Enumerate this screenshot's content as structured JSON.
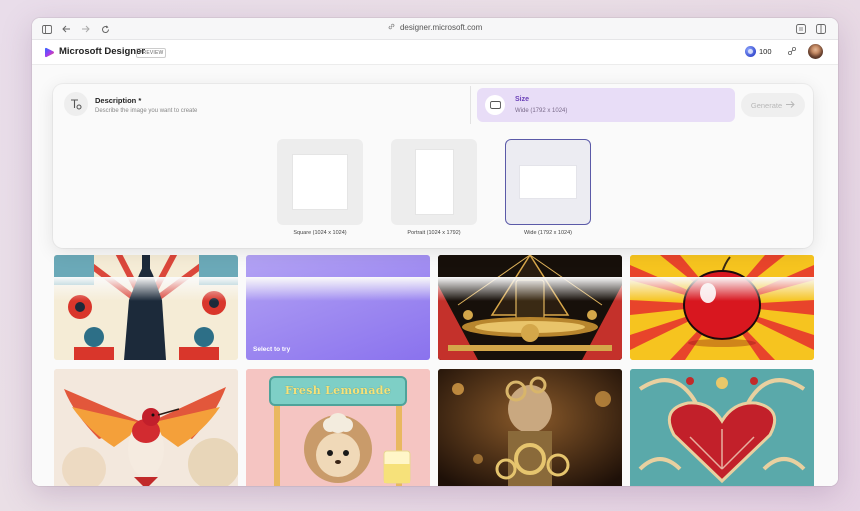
{
  "browser": {
    "url": "designer.microsoft.com"
  },
  "app": {
    "name": "Microsoft Designer",
    "badge": "PREVIEW",
    "credits": "100"
  },
  "prompt": {
    "title": "Description *",
    "placeholder": "Describe the image you want to create"
  },
  "size": {
    "title": "Size",
    "value": "Wide (1792 x 1024)",
    "options": [
      {
        "label": "Square (1024 x 1024)"
      },
      {
        "label": "Portrait (1024 x 1792)"
      },
      {
        "label": "Wide (1792 x 1024)",
        "selected": true
      }
    ]
  },
  "generate_label": "Generate",
  "gallery": {
    "select_label": "Select to try",
    "lemonade_sign": "Fresh Lemonade"
  },
  "colors": {
    "accent": "#6a3fb8",
    "size_bg": "#e8ddf7",
    "selected_border": "#5b5aa8",
    "tile_purple": "#9d86f0"
  }
}
